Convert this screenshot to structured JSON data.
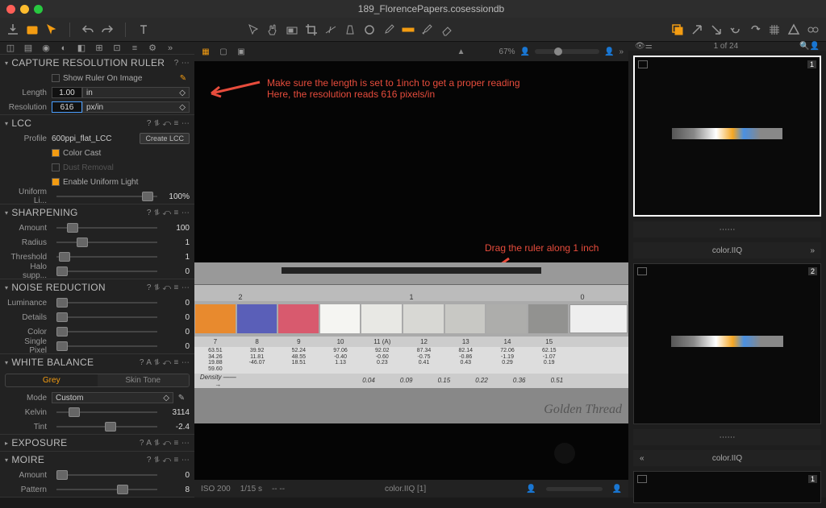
{
  "window": {
    "title": "189_FlorencePapers.cosessiondb"
  },
  "toolbar": {
    "zoom": "67%"
  },
  "panels": {
    "ruler": {
      "title": "CAPTURE RESOLUTION RULER",
      "showRuler": "Show Ruler On Image",
      "lengthLabel": "Length",
      "lengthVal": "1.00",
      "lengthUnit": "in",
      "resLabel": "Resolution",
      "resVal": "616",
      "resUnit": "px/in"
    },
    "lcc": {
      "title": "LCC",
      "profileLabel": "Profile",
      "profileVal": "600ppi_flat_LCC",
      "createBtn": "Create LCC",
      "colorCast": "Color Cast",
      "dustRemoval": "Dust Removal",
      "uniformLight": "Enable Uniform Light",
      "uniformLiLabel": "Uniform Li...",
      "uniformVal": "100%"
    },
    "sharpening": {
      "title": "SHARPENING",
      "amountLabel": "Amount",
      "amountVal": "100",
      "radiusLabel": "Radius",
      "radiusVal": "1",
      "thresholdLabel": "Threshold",
      "thresholdVal": "1",
      "haloLabel": "Halo supp...",
      "haloVal": "0"
    },
    "noise": {
      "title": "NOISE REDUCTION",
      "lumLabel": "Luminance",
      "lumVal": "0",
      "detLabel": "Details",
      "detVal": "0",
      "colLabel": "Color",
      "colVal": "0",
      "spLabel": "Single Pixel",
      "spVal": "0"
    },
    "wb": {
      "title": "WHITE BALANCE",
      "tabGrey": "Grey",
      "tabSkin": "Skin Tone",
      "modeLabel": "Mode",
      "modeVal": "Custom",
      "kelvinLabel": "Kelvin",
      "kelvinVal": "3114",
      "tintLabel": "Tint",
      "tintVal": "-2.4"
    },
    "exposure": {
      "title": "EXPOSURE"
    },
    "moire": {
      "title": "MOIRE",
      "amountLabel": "Amount",
      "amountVal": "0",
      "patternLabel": "Pattern",
      "patternVal": "8"
    }
  },
  "annotations": {
    "top1": "Make sure the length is set to 1inch to get a proper reading",
    "top2": "Here, the resolution reads 616 pixels/in",
    "mid": "Drag the ruler along 1 inch"
  },
  "patches": {
    "nums": [
      "7",
      "8",
      "9",
      "10",
      "11 (A)",
      "12",
      "13",
      "14",
      "15"
    ],
    "vals": [
      [
        "63.51",
        "34.26",
        "19.88",
        "59.60"
      ],
      [
        "39.92",
        "11.81",
        "-46.07",
        ""
      ],
      [
        "52.24",
        "48.55",
        "18.51",
        ""
      ],
      [
        "97.06",
        "-0.40",
        "1.13",
        ""
      ],
      [
        "92.02",
        "-0.60",
        "0.23",
        ""
      ],
      [
        "87.34",
        "-0.75",
        "0.41",
        ""
      ],
      [
        "82.14",
        "-0.86",
        "0.43",
        ""
      ],
      [
        "72.06",
        "-1.19",
        "0.29",
        ""
      ],
      [
        "62.15",
        "-1.07",
        "0.19",
        ""
      ]
    ],
    "densityLabel": "Density ——→",
    "density": [
      "",
      "",
      "",
      "0.04",
      "0.09",
      "0.15",
      "0.22",
      "0.36",
      "0.51"
    ],
    "golden": "Golden Thread"
  },
  "status": {
    "iso": "ISO 200",
    "shutter": "1/15 s",
    "dash": "--  --",
    "filename": "color.IIQ [1]"
  },
  "browser": {
    "counter": "1 of 24",
    "thumb1": "color.IIQ",
    "thumb2": "color.IIQ",
    "badge1": "1",
    "badge2": "2"
  }
}
